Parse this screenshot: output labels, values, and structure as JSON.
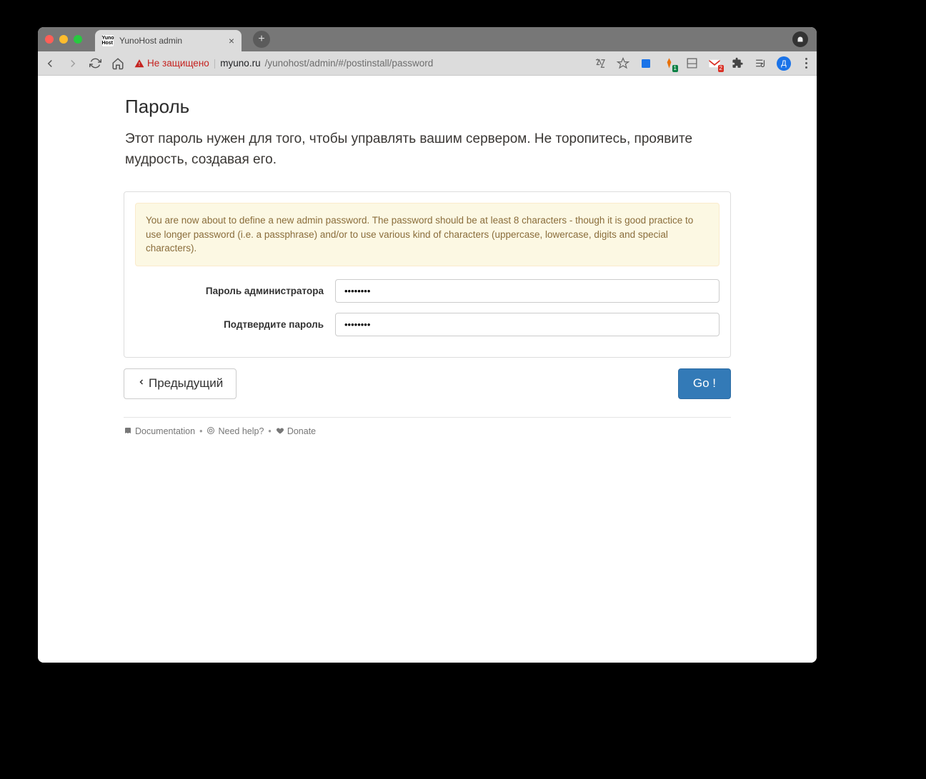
{
  "browser": {
    "tab_title": "YunoHost admin",
    "insecure_label": "Не защищено",
    "url_host": "myuno.ru",
    "url_path": "/yunohost/admin/#/postinstall/password",
    "avatar_initial": "Д"
  },
  "page": {
    "title": "Пароль",
    "description": "Этот пароль нужен для того, чтобы управлять вашим сервером. Не торопитесь, проявите мудрость, создавая его.",
    "alert": "You are now about to define a new admin password. The password should be at least 8 characters - though it is good practice to use longer password (i.e. a passphrase) and/or to use various kind of characters (uppercase, lowercase, digits and special characters).",
    "fields": {
      "admin_password_label": "Пароль администратора",
      "admin_password_value": "••••••••",
      "confirm_password_label": "Подтвердите пароль",
      "confirm_password_value": "••••••••"
    },
    "buttons": {
      "prev": "Предыдущий",
      "go": "Go !"
    },
    "footer": {
      "docs": "Documentation",
      "help": "Need help?",
      "donate": "Donate"
    }
  }
}
